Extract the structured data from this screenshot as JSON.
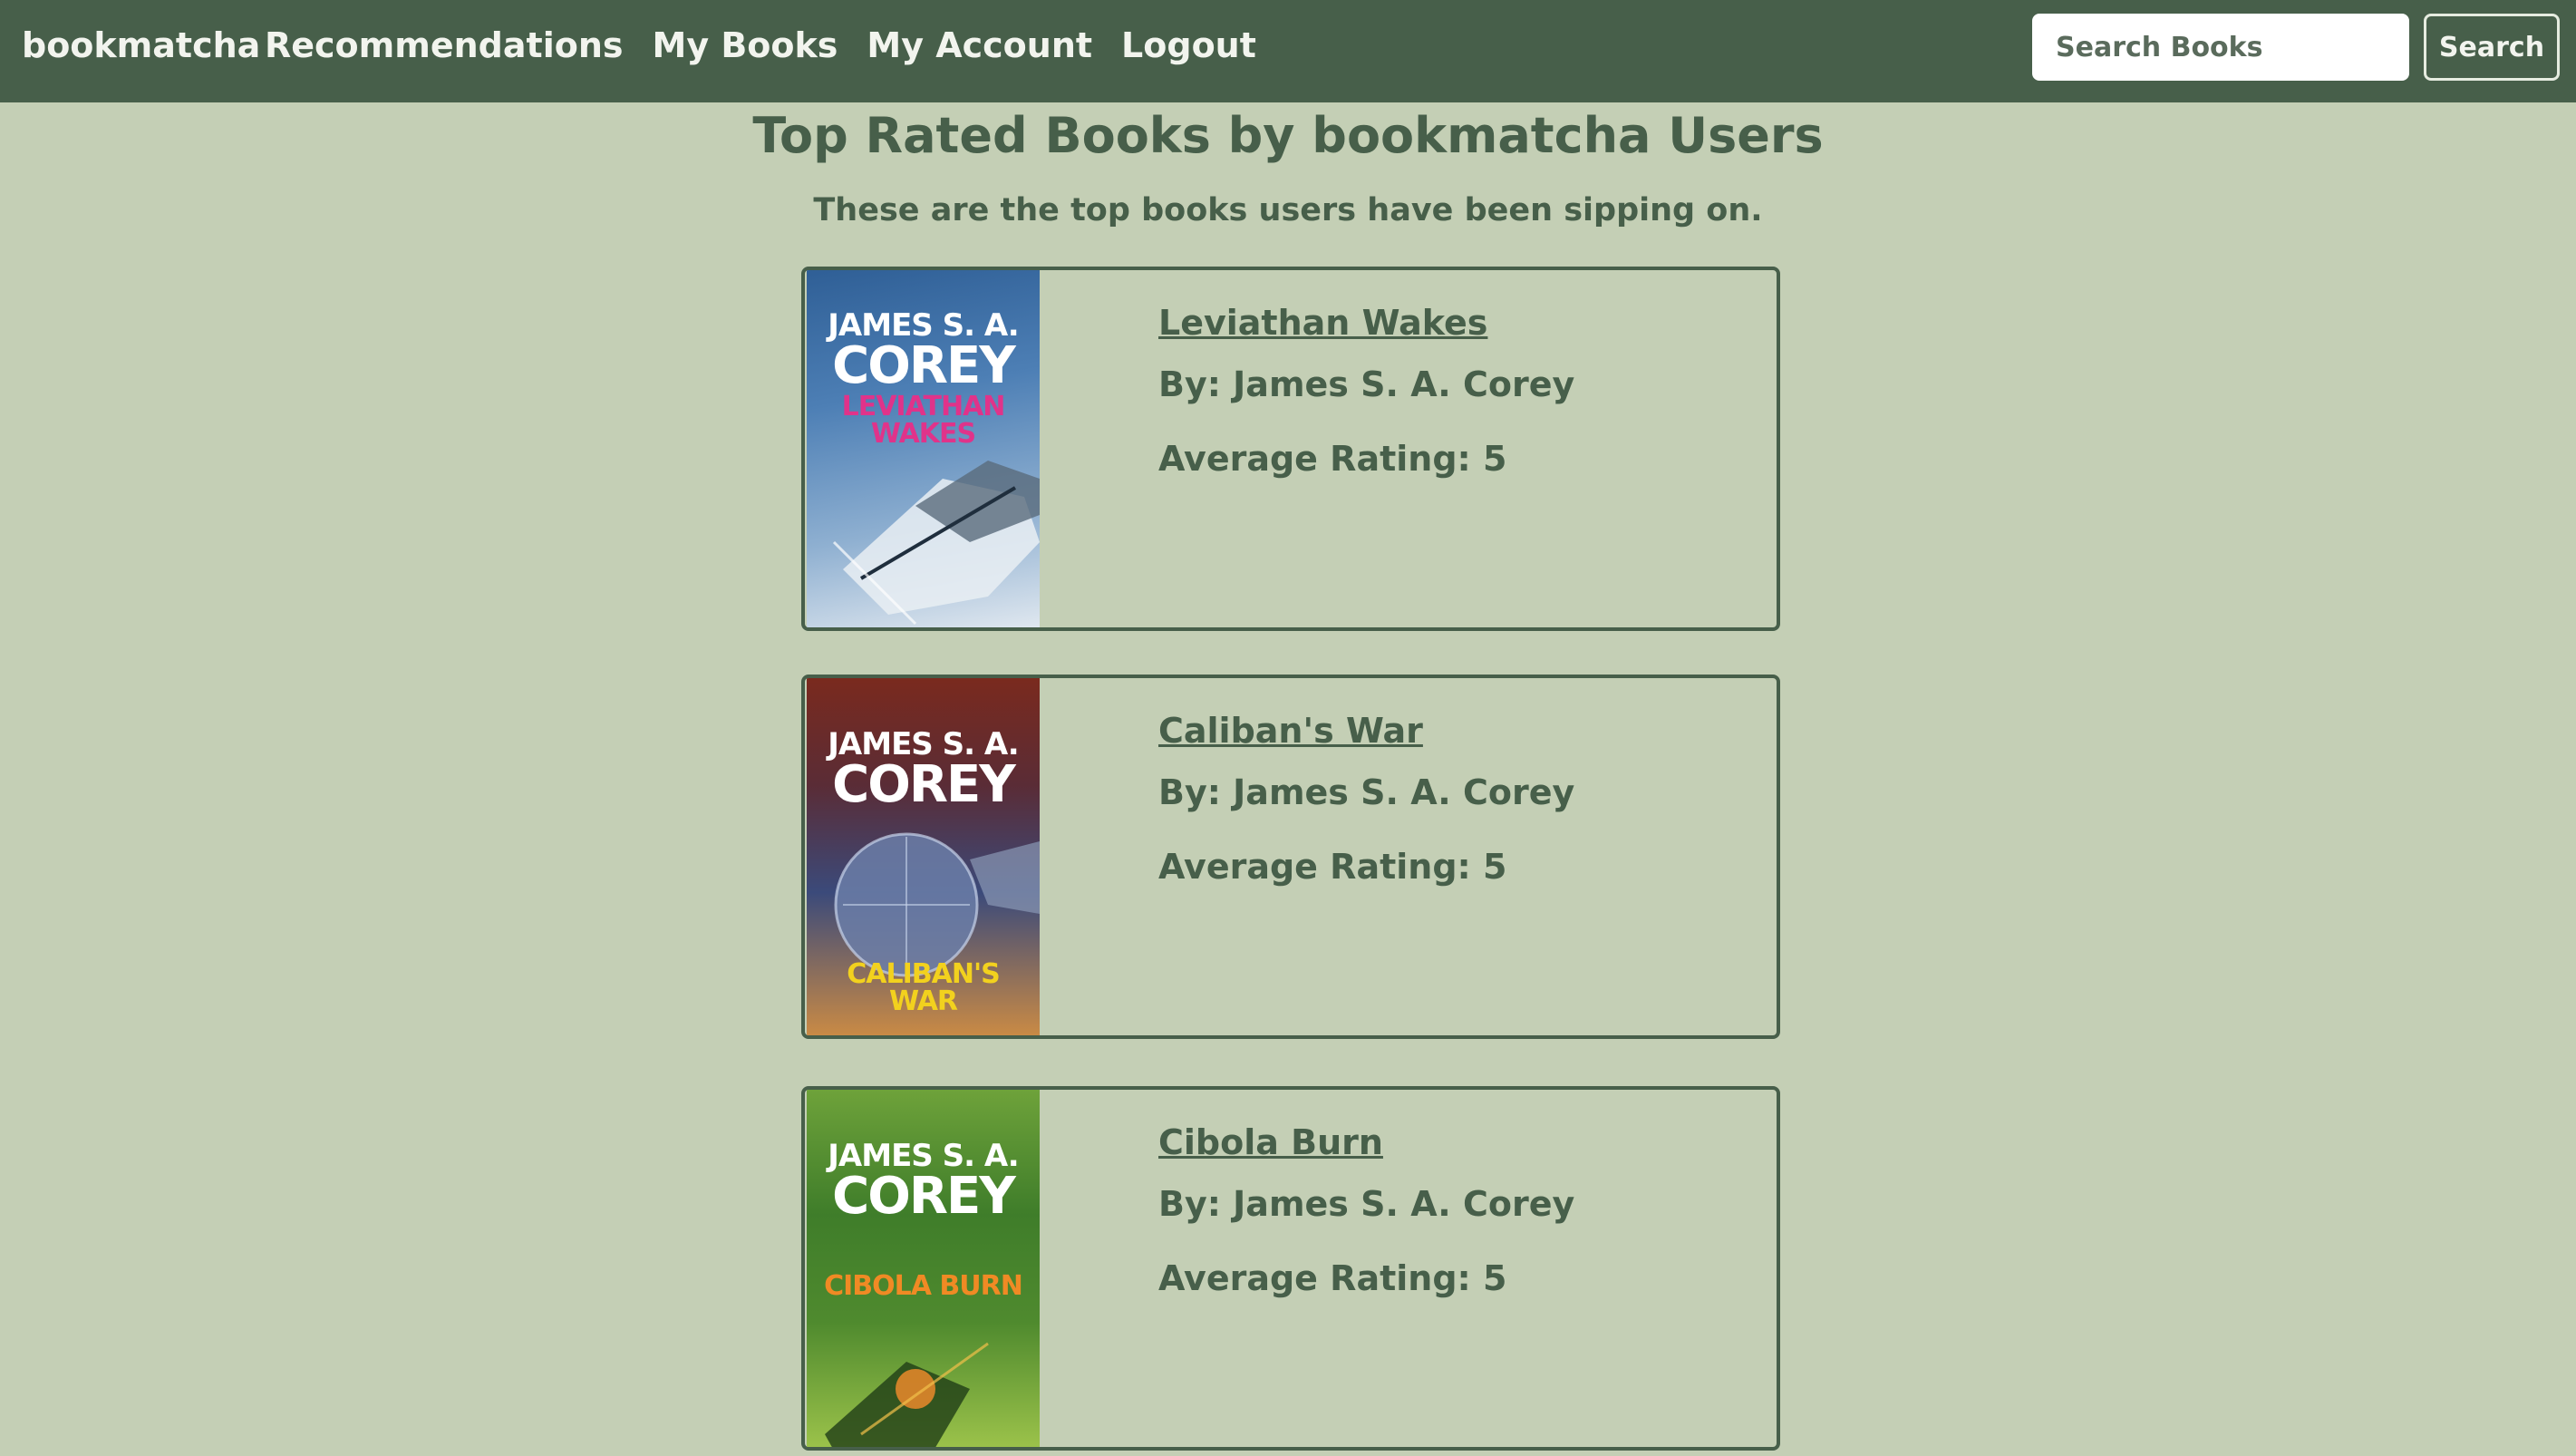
{
  "navbar": {
    "brand": "bookmatcha",
    "links": [
      "Recommendations",
      "My Books",
      "My Account",
      "Logout"
    ],
    "search_placeholder": "Search Books",
    "search_label": "Search"
  },
  "header": {
    "title": "Top Rated Books by bookmatcha Users",
    "subtitle": "These are the top books users have been sipping on."
  },
  "books": [
    {
      "title": "Leviathan Wakes",
      "author": "By: James S. A. Corey",
      "rating": "Average Rating: 5",
      "cover": {
        "author_line1": "JAMES S. A.",
        "author_line2": "COREY",
        "title_line1": "LEVIATHAN",
        "title_line2": "WAKES",
        "title_color": "#e0338a",
        "bg_top": "#2f5f96",
        "bg_bottom": "#c9d7e6"
      }
    },
    {
      "title": "Caliban's War",
      "author": "By: James S. A. Corey",
      "rating": "Average Rating: 5",
      "cover": {
        "author_line1": "JAMES S. A.",
        "author_line2": "COREY",
        "title_line1": "CALIBAN'S",
        "title_line2": "WAR",
        "title_color": "#f2d11e",
        "bg_top": "#7a2a1e",
        "bg_bottom": "#3b4a7a"
      }
    },
    {
      "title": "Cibola Burn",
      "author": "By: James S. A. Corey",
      "rating": "Average Rating: 5",
      "cover": {
        "author_line1": "JAMES S. A.",
        "author_line2": "COREY",
        "title_line1": "CIBOLA BURN",
        "title_line2": "",
        "title_color": "#f08a24",
        "bg_top": "#3f7d2a",
        "bg_bottom": "#9bc24a"
      }
    }
  ],
  "colors": {
    "nav_bg": "#475f4a",
    "page_bg": "#c4cfb5",
    "text": "#475f4a"
  }
}
